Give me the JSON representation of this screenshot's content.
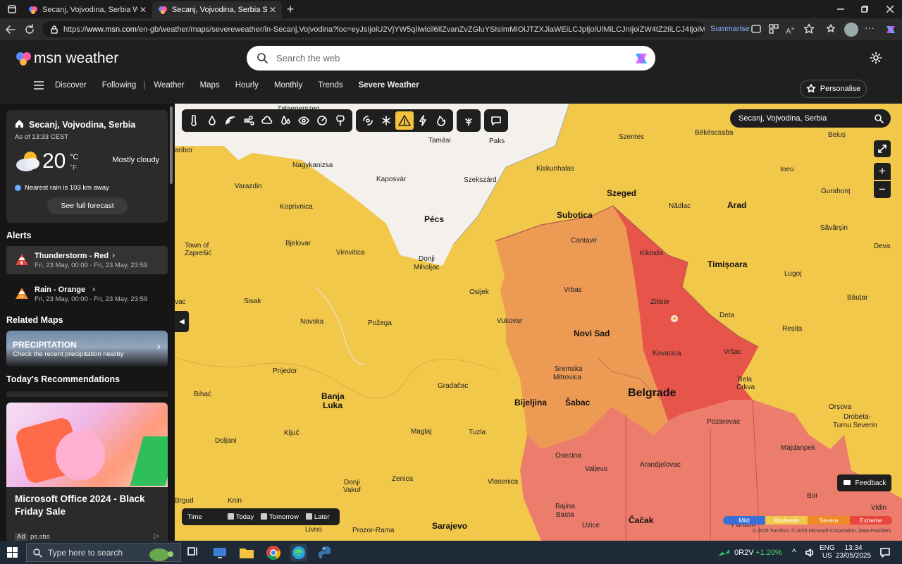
{
  "browser": {
    "tabs": [
      {
        "title": "Secanj, Vojvodina, Serbia Weathe"
      },
      {
        "title": "Secanj, Vojvodina, Serbia Severe W"
      }
    ],
    "url_prefix": "https://",
    "url_domain": "www.msn.com",
    "url_rest": "/en-gb/weather/maps/severeweather/in-Secanj,Vojvodina?loc=eyJsIjoiU2VjYW5qIiwicil6IlZvanZvZGluYSIsImMiOiJTZXJiaWEiLCJpIjoiUlMiLCJnIjoiZW4tZ2IiLCJ4IjoiMjAuNjk3...",
    "summarise_label": "Summarise"
  },
  "header": {
    "logo_text": "msn weather",
    "search_placeholder": "Search the web",
    "nav": [
      "Discover",
      "Following",
      "Weather",
      "Maps",
      "Hourly",
      "Monthly",
      "Trends",
      "Severe Weather"
    ],
    "personalise_label": "Personalise"
  },
  "current": {
    "location": "Secanj, Vojvodina, Serbia",
    "as_of": "As of 13:33 CEST",
    "temperature": "20",
    "unit_c": "°C",
    "unit_f": "°F",
    "condition": "Mostly cloudy",
    "nearest_rain": "Nearest rain is 103 km away",
    "forecast_button": "See full forecast"
  },
  "alerts": {
    "title": "Alerts",
    "items": [
      {
        "name": "Thunderstorm - Red",
        "time": "Fri, 23 May, 00:00 - Fri, 23 May, 23:59",
        "color": "#e8453c"
      },
      {
        "name": "Rain - Orange",
        "time": "Fri, 23 May, 00:00 - Fri, 23 May, 23:59",
        "color": "#f08a24"
      }
    ]
  },
  "related_maps": {
    "title": "Related Maps",
    "card_title": "PRECIPITATION",
    "card_sub": "Check the recent precipitation nearby"
  },
  "recommendations": {
    "title": "Today's Recommendations",
    "ad_title": "Microsoft Office 2024 - Black Friday Sale",
    "ad_label": "Ad",
    "ad_source": "ps.sbs"
  },
  "map": {
    "search_value": "Secanj, Vojvodina, Serbia",
    "time_label": "Time",
    "time_options": [
      "Today",
      "Tomorrow",
      "Later"
    ],
    "legend": [
      {
        "label": "Mild",
        "color": "#3a6fd8"
      },
      {
        "label": "Moderate",
        "color": "#f2c84b"
      },
      {
        "label": "Severe",
        "color": "#f08a24"
      },
      {
        "label": "Extreme",
        "color": "#e8453c"
      }
    ],
    "copyright": "© 2025 TomTom, © 2025 Microsoft Corporation, Data Providers",
    "feedback_label": "Feedback",
    "cities": {
      "zalaegerszeg": "Zalaegerszeg",
      "tamasi": "Tamási",
      "paks": "Paks",
      "szentes": "Szentes",
      "bekescsaba": "Békéscsaba",
      "beius": "Beiuș",
      "maribor": "aribor",
      "nagykanizsa": "Nagykanizsa",
      "kiskunhalas": "Kiskunhalas",
      "ineu": "Ineu",
      "kaposvar": "Kaposvár",
      "szekszard": "Szekszárd",
      "szeged": "Szeged",
      "gurahont": "Gurahonț",
      "varazdin": "Varazdin",
      "subotica": "Subotica",
      "nadlac": "Nădlac",
      "arad": "Arad",
      "koprivnica": "Koprivnica",
      "pecs": "Pécs",
      "savarsin": "Săvârșin",
      "cantavir": "Cantavir",
      "deva": "Deva",
      "town_of": "Town of",
      "zapresic": "Zaprešić",
      "bjelovar": "Bjelovar",
      "virovitica": "Virovitica",
      "donji_miholjac_1": "Donji",
      "donji_miholjac_2": "Miholjac",
      "kikinda": "Kikinda",
      "timisoara": "Timișoara",
      "lugoj": "Lugoj",
      "osijek": "Osijek",
      "vrbas": "Vrbas",
      "vac": "vac",
      "sisak": "Sisak",
      "zitiste": "Zitiste",
      "bautar": "Băuțar",
      "novska": "Novska",
      "pozega": "Požega",
      "vukovar": "Vukovar",
      "deta": "Deta",
      "novi_sad": "Novi Sad",
      "resita": "Reșița",
      "kovacica": "Kovacica",
      "vrsac": "Vršac",
      "prijedor": "Prijedor",
      "sremska_1": "Sremska",
      "sremska_2": "Mitrovica",
      "bela_crkva_1": "Bela",
      "bela_crkva_2": "Crkva",
      "bihac": "Bihać",
      "banja_luka_1": "Banja",
      "banja_luka_2": "Luka",
      "gradacac": "Gradačac",
      "bijeljina": "Bijeljina",
      "sabac": "Šabac",
      "belgrade": "Belgrade",
      "orsova": "Orșova",
      "drobeta_1": "Drobeta-",
      "drobeta_2": "Turnu Severin",
      "pozarevac": "Pozarevac",
      "kljuc": "Ključ",
      "maglaj": "Maglaj",
      "tuzla": "Tuzla",
      "majdanpek": "Majdanpek",
      "doljani": "Doljani",
      "osecina": "Osecina",
      "valjevo": "Valjevo",
      "arandjelovac": "Arandjelovac",
      "zenica": "Zenica",
      "donji_vakuf_1": "Donji",
      "donji_vakuf_2": "Vakuf",
      "vlasenica": "Vlasenica",
      "bor": "Bor",
      "brgud": "Brgud",
      "knin": "Knin",
      "bajina_1": "Bajina",
      "bajina_2": "Basta",
      "vidin": "Vidin",
      "sarajevo": "Sarajevo",
      "uzice": "Uzice",
      "cacak": "Čačak",
      "paracin": "Paracin",
      "livno": "Livno",
      "prozor": "Prozor-Rama"
    }
  },
  "taskbar": {
    "search_placeholder": "Type here to search",
    "stock_name": "0R2V",
    "stock_change": "+1.20%",
    "lang_1": "ENG",
    "lang_2": "US",
    "time": "13:34",
    "date": "23/05/2025"
  }
}
